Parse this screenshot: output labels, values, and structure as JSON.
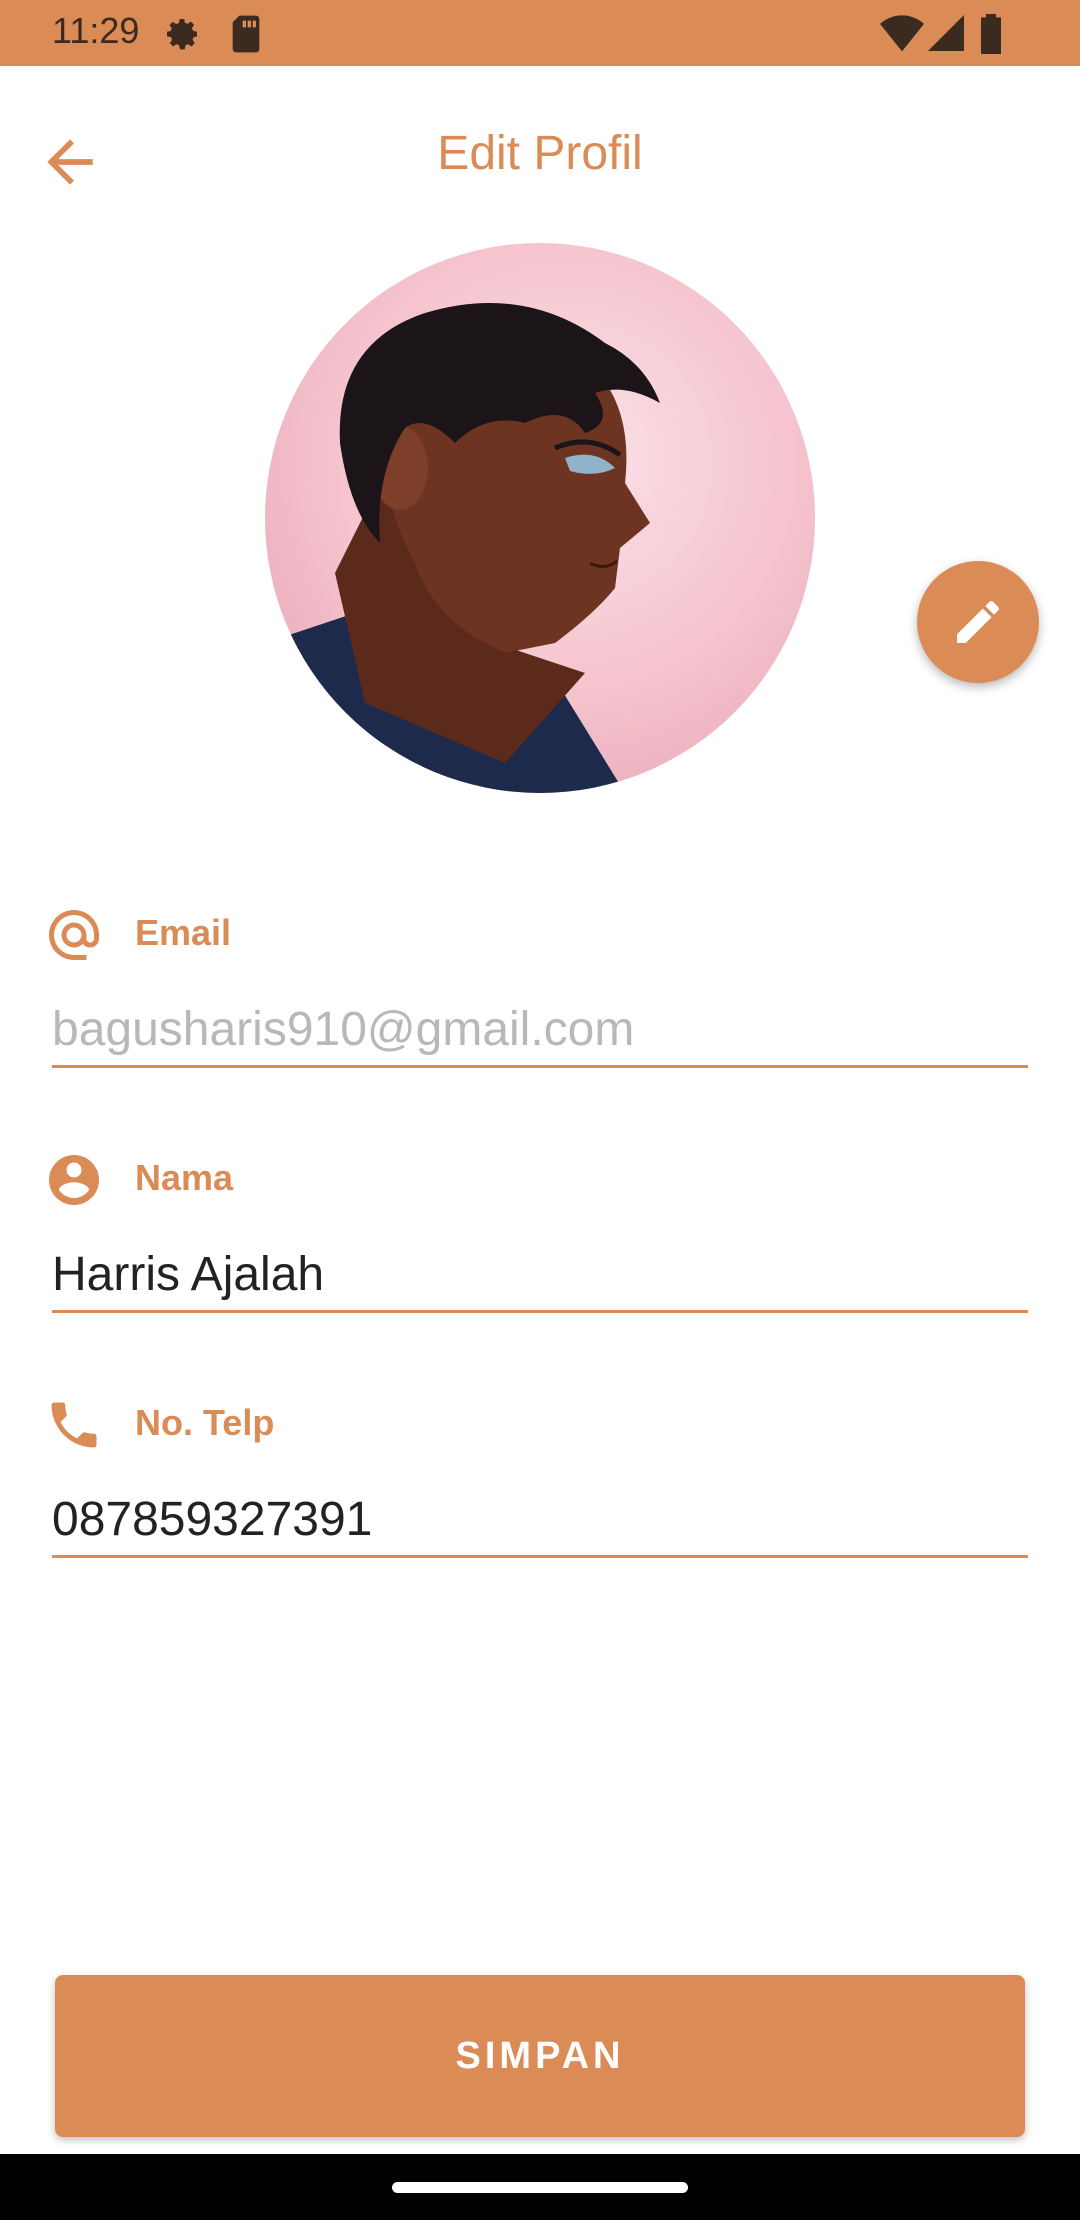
{
  "status_bar": {
    "time": "11:29",
    "icons": [
      "gear-icon",
      "sd-card-icon",
      "wifi-icon",
      "signal-icon",
      "battery-icon"
    ]
  },
  "app_bar": {
    "title": "Edit Profil",
    "back_icon": "arrow-back-icon"
  },
  "profile": {
    "avatar": "anime-style portrait avatar",
    "edit_icon": "pencil-icon"
  },
  "form": {
    "email": {
      "label": "Email",
      "value": "bagusharis910@gmail.com",
      "icon": "at-sign-icon"
    },
    "name": {
      "label": "Nama",
      "value": "Harris Ajalah",
      "icon": "person-icon"
    },
    "phone": {
      "label": "No. Telp",
      "value": "087859327391",
      "icon": "phone-icon"
    }
  },
  "actions": {
    "save_label": "SIMPAN"
  },
  "colors": {
    "accent": "#DB8B55",
    "background": "#FFFFFF",
    "nav_bar": "#000000"
  }
}
